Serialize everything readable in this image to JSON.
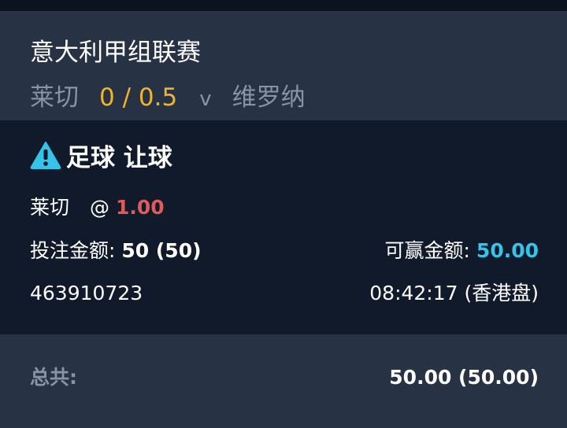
{
  "header": {
    "league": "意大利甲组联赛",
    "home_team": "莱切",
    "handicap": "0 / 0.5",
    "vs": "v",
    "away_team": "维罗纳"
  },
  "bet": {
    "icon": "warning-icon",
    "title": "足球 让球",
    "selection": "莱切",
    "odds_prefix": "@",
    "odds": "1.00",
    "stake_label": "投注金额:",
    "stake_value": "50 (50)",
    "win_label": "可赢金额:",
    "win_value": "50.00",
    "bet_id": "463910723",
    "time": "08:42:17 (香港盘)"
  },
  "total": {
    "label": "总共:",
    "value": "50.00 (50.00)"
  },
  "colors": {
    "handicap": "#f0b429",
    "odds": "#e05a5a",
    "win_value": "#35c4e8",
    "warning_icon": "#35c4e8"
  }
}
